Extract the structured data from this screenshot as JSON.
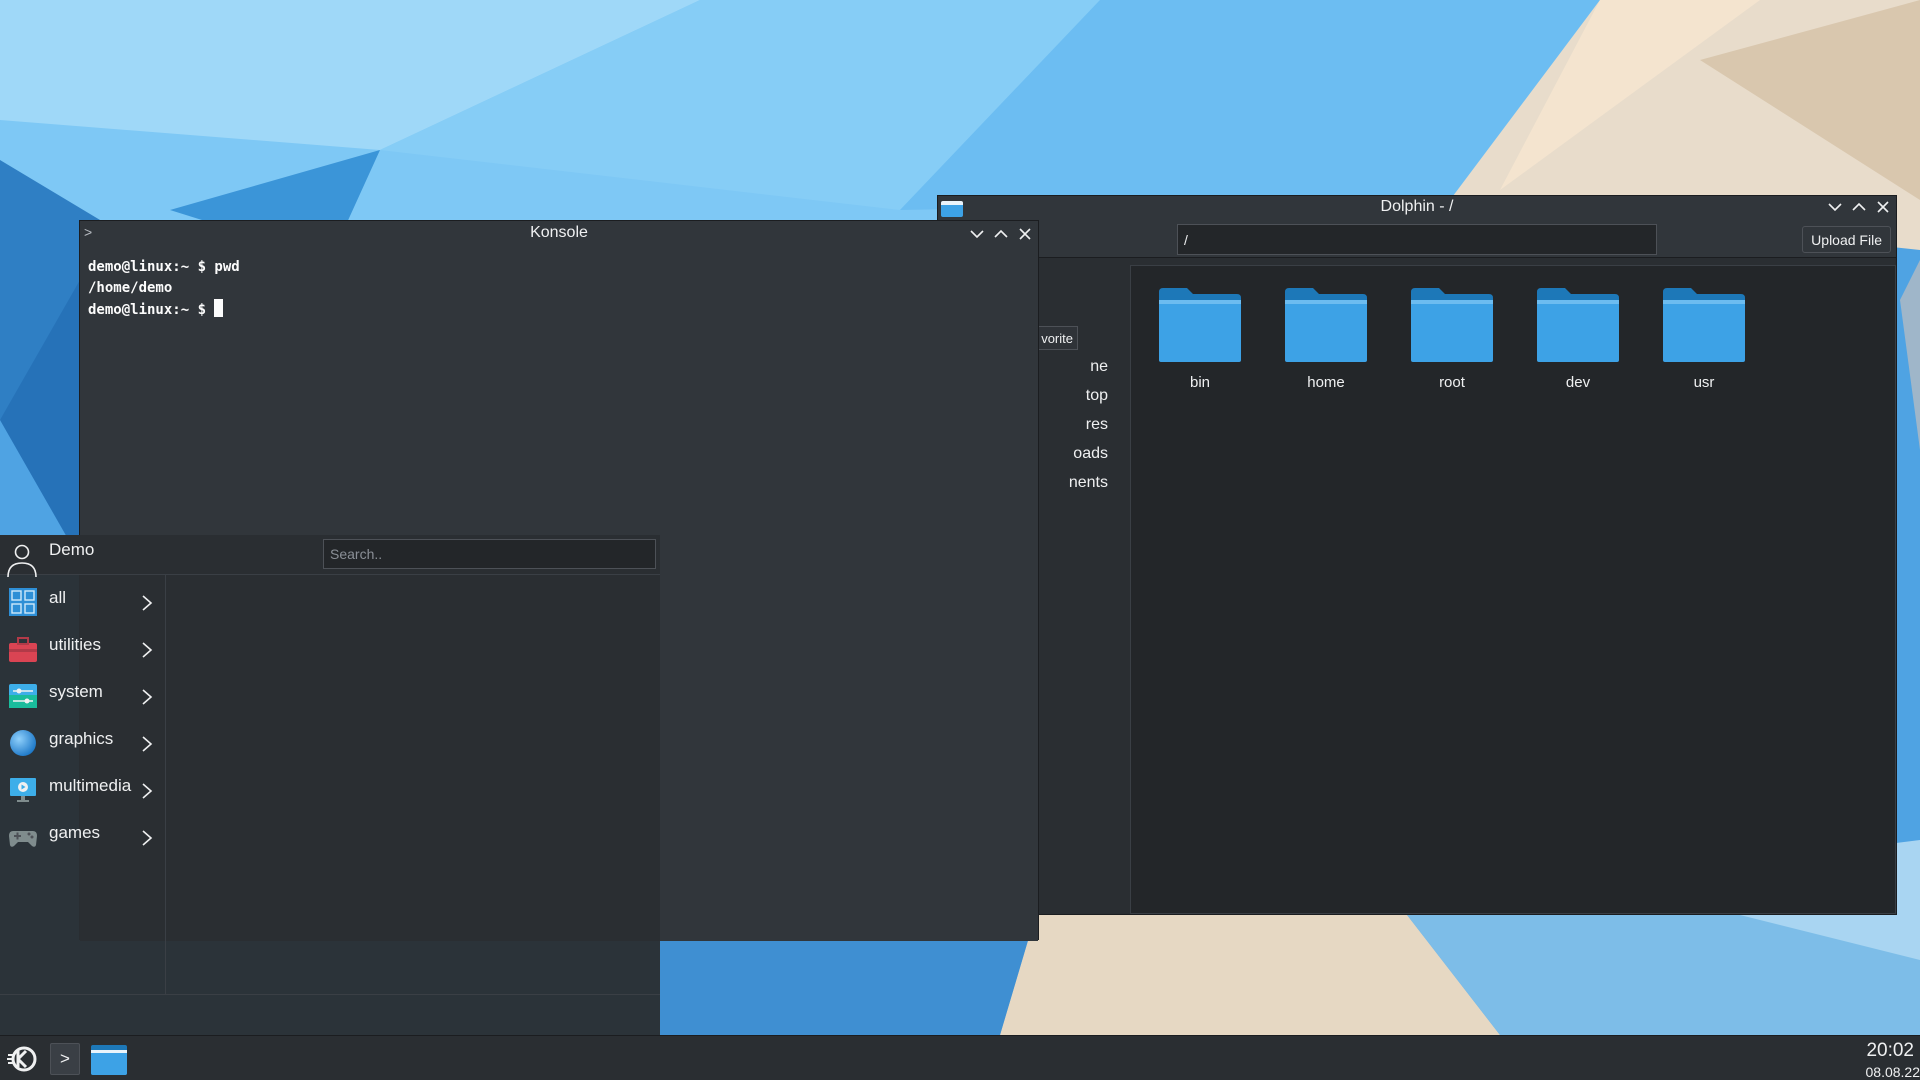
{
  "dolphin": {
    "title": "Dolphin - /",
    "location": "/",
    "upload_label": "Upload File",
    "places": [
      "vorite",
      "ne",
      "top",
      "res",
      "oads",
      "nents"
    ],
    "files": [
      {
        "name": "bin",
        "icon": "folder-icon"
      },
      {
        "name": "home",
        "icon": "folder-icon"
      },
      {
        "name": "root",
        "icon": "folder-icon"
      },
      {
        "name": "dev",
        "icon": "folder-icon"
      },
      {
        "name": "usr",
        "icon": "folder-icon"
      }
    ]
  },
  "konsole": {
    "title": "Konsole",
    "lines": [
      "demo@linux:~ $ pwd",
      "/home/demo",
      "demo@linux:~ $ "
    ]
  },
  "launcher": {
    "user": "Demo",
    "search_placeholder": "Search..",
    "categories": [
      {
        "label": "all",
        "icon": "grid-icon"
      },
      {
        "label": "utilities",
        "icon": "toolbox-icon"
      },
      {
        "label": "system",
        "icon": "settings-sliders-icon"
      },
      {
        "label": "graphics",
        "icon": "sphere-icon"
      },
      {
        "label": "multimedia",
        "icon": "monitor-play-icon"
      },
      {
        "label": "games",
        "icon": "gamepad-icon"
      }
    ]
  },
  "taskbar": {
    "time": "20:02",
    "date": "08.08.22"
  },
  "colors": {
    "window_bg": "#31363b",
    "view_bg": "#232629",
    "folder_blue": "#3da2e6",
    "text": "#eff0f1"
  }
}
